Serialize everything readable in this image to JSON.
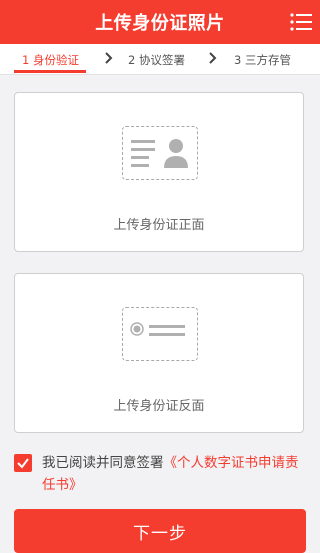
{
  "header": {
    "title": "上传身份证照片",
    "menu_icon": "list-menu-icon"
  },
  "steps": [
    {
      "label": "1 身份验证",
      "active": true
    },
    {
      "label": "2 协议签署",
      "active": false
    },
    {
      "label": "3 三方存管",
      "active": false
    }
  ],
  "upload": {
    "front_label": "上传身份证正面",
    "back_label": "上传身份证反面"
  },
  "agreement": {
    "checked": true,
    "text": "我已阅读并同意签署",
    "link": "《个人数字证书申请责任书》"
  },
  "next_button": "下一步",
  "colors": {
    "accent": "#f43c2f",
    "background": "#f2f2f4"
  }
}
